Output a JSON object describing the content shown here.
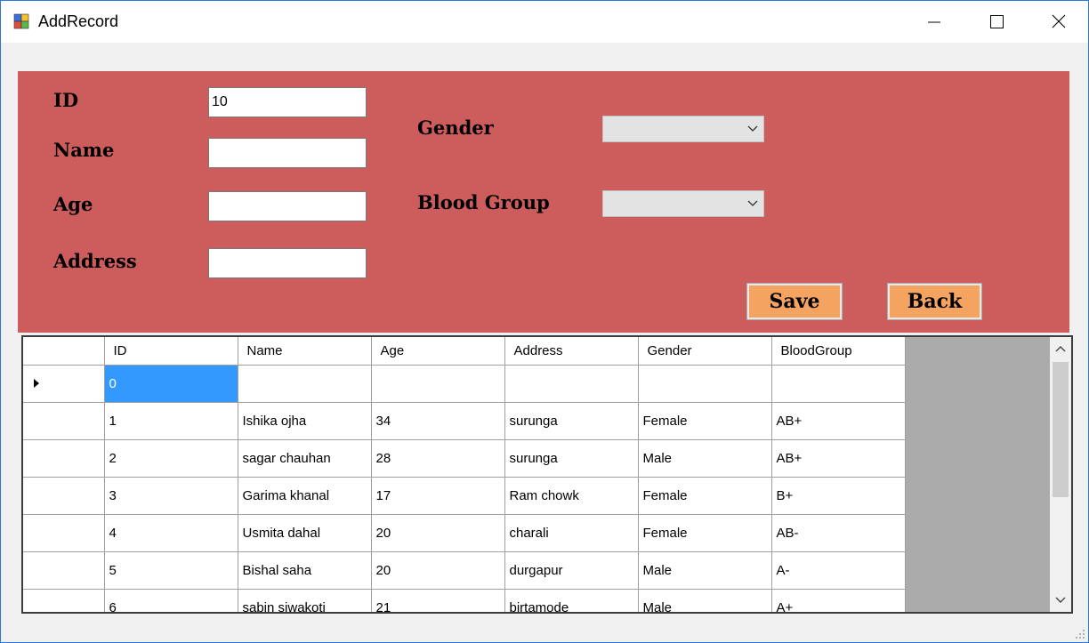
{
  "window": {
    "title": "AddRecord"
  },
  "form": {
    "id_label": "ID",
    "id_value": "10",
    "name_label": "Name",
    "name_value": "",
    "age_label": "Age",
    "age_value": "",
    "address_label": "Address",
    "address_value": "",
    "gender_label": "Gender",
    "gender_value": "",
    "blood_group_label": "Blood Group",
    "blood_group_value": "",
    "save_label": "Save",
    "back_label": "Back"
  },
  "grid": {
    "columns": [
      "ID",
      "Name",
      "Age",
      "Address",
      "Gender",
      "BloodGroup"
    ],
    "rows": [
      [
        "0",
        "",
        "",
        "",
        "",
        ""
      ],
      [
        "1",
        "Ishika ojha",
        "34",
        "surunga",
        "Female",
        "AB+"
      ],
      [
        "2",
        "sagar chauhan",
        "28",
        "surunga",
        "Male",
        "AB+"
      ],
      [
        "3",
        "Garima khanal",
        "17",
        "Ram chowk",
        "Female",
        "B+"
      ],
      [
        "4",
        "Usmita dahal",
        "20",
        "charali",
        "Female",
        "AB-"
      ],
      [
        "5",
        "Bishal saha",
        "20",
        "durgapur",
        "Male",
        "A-"
      ],
      [
        "6",
        "sabin siwakoti",
        "21",
        "birtamode",
        "Male",
        "A+"
      ]
    ]
  },
  "colors": {
    "panel": "#cd5c5c",
    "button": "#f4a460",
    "selection": "#3399ff"
  },
  "icons": [
    "app-icon",
    "minimize-icon",
    "maximize-icon",
    "close-icon",
    "chevron-down-icon",
    "row-pointer-icon",
    "scroll-up-icon",
    "scroll-down-icon",
    "size-grip-icon"
  ]
}
